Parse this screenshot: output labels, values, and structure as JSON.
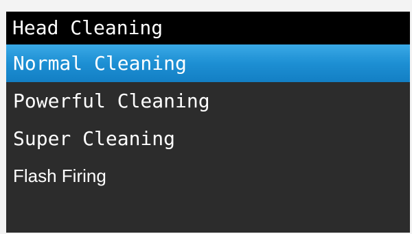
{
  "title": "Head Cleaning",
  "menu": {
    "items": [
      {
        "label": "Normal Cleaning",
        "selected": true
      },
      {
        "label": "Powerful Cleaning",
        "selected": false
      },
      {
        "label": "Super Cleaning",
        "selected": false
      },
      {
        "label": "Flash Firing",
        "selected": false
      }
    ]
  },
  "colors": {
    "background": "#2c2c2c",
    "title_bar": "#000000",
    "selected_item": "#1d8fd3",
    "text": "#ffffff"
  }
}
